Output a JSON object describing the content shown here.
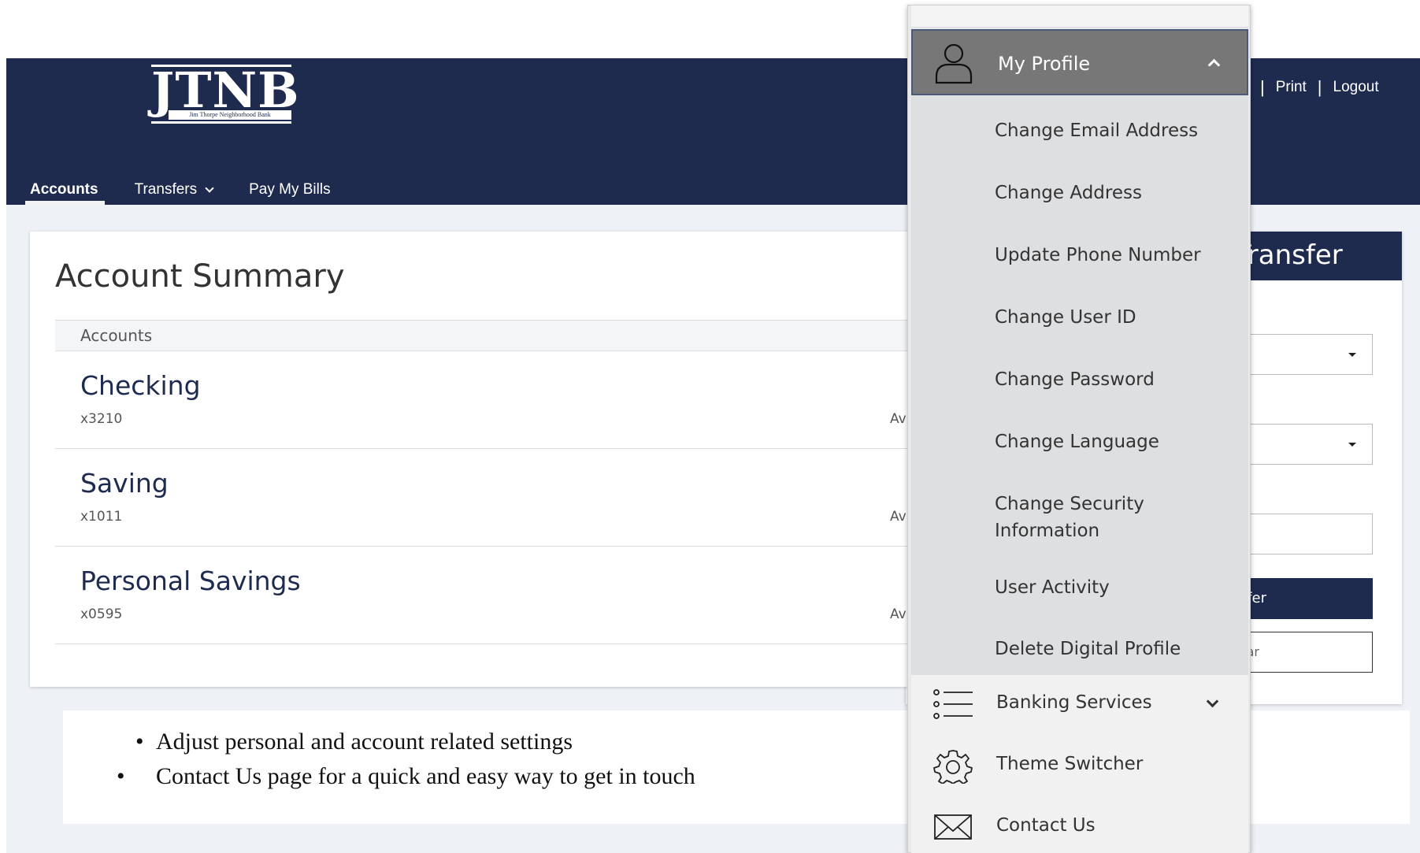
{
  "header": {
    "logo_text": "JTNB",
    "logo_subtitle": "Jim Thorpe Neighborhood Bank",
    "top_links": {
      "sep1": "|",
      "print": "Print",
      "sep2": "|",
      "logout": "Logout"
    }
  },
  "nav": {
    "items": [
      {
        "label": "Accounts",
        "active": true
      },
      {
        "label": "Transfers",
        "active": false
      },
      {
        "label": "Pay My Bills",
        "active": false
      }
    ]
  },
  "account_summary": {
    "title": "Account Summary",
    "list_header": "Accounts",
    "accounts": [
      {
        "name": "Checking",
        "number": "x3210",
        "avail_fragment": "Av"
      },
      {
        "name": "Saving",
        "number": "x1011",
        "avail_fragment": "Av"
      },
      {
        "name": "Personal Savings",
        "number": "x0595",
        "avail_fragment": "Av"
      }
    ]
  },
  "transfer_panel": {
    "title_fragment": "Transfer",
    "button_fragment": "sfer",
    "clear_fragment": "ear"
  },
  "notes": {
    "bullets": [
      "Adjust personal and account related settings",
      "Contact Us page for a quick and easy way to get in touch"
    ],
    "bullet_char": "•"
  },
  "menu": {
    "profile_label": "My Profile",
    "profile_icon": "user-icon",
    "profile_items": [
      "Change Email Address",
      "Change Address",
      "Update Phone Number",
      "Change User ID",
      "Change Password",
      "Change Language",
      "Change Security Information",
      "User Activity",
      "Delete Digital Profile"
    ],
    "banking_services": {
      "label": "Banking Services",
      "icon": "list-icon"
    },
    "theme_switcher": {
      "label": "Theme Switcher",
      "icon": "gear-icon"
    },
    "contact_us": {
      "label": "Contact Us",
      "icon": "envelope-icon"
    }
  },
  "colors": {
    "navy": "#1e2b4f",
    "menu_header_gray": "#777777",
    "submenu_gray": "#dedfe1",
    "background": "#eef1f5"
  }
}
